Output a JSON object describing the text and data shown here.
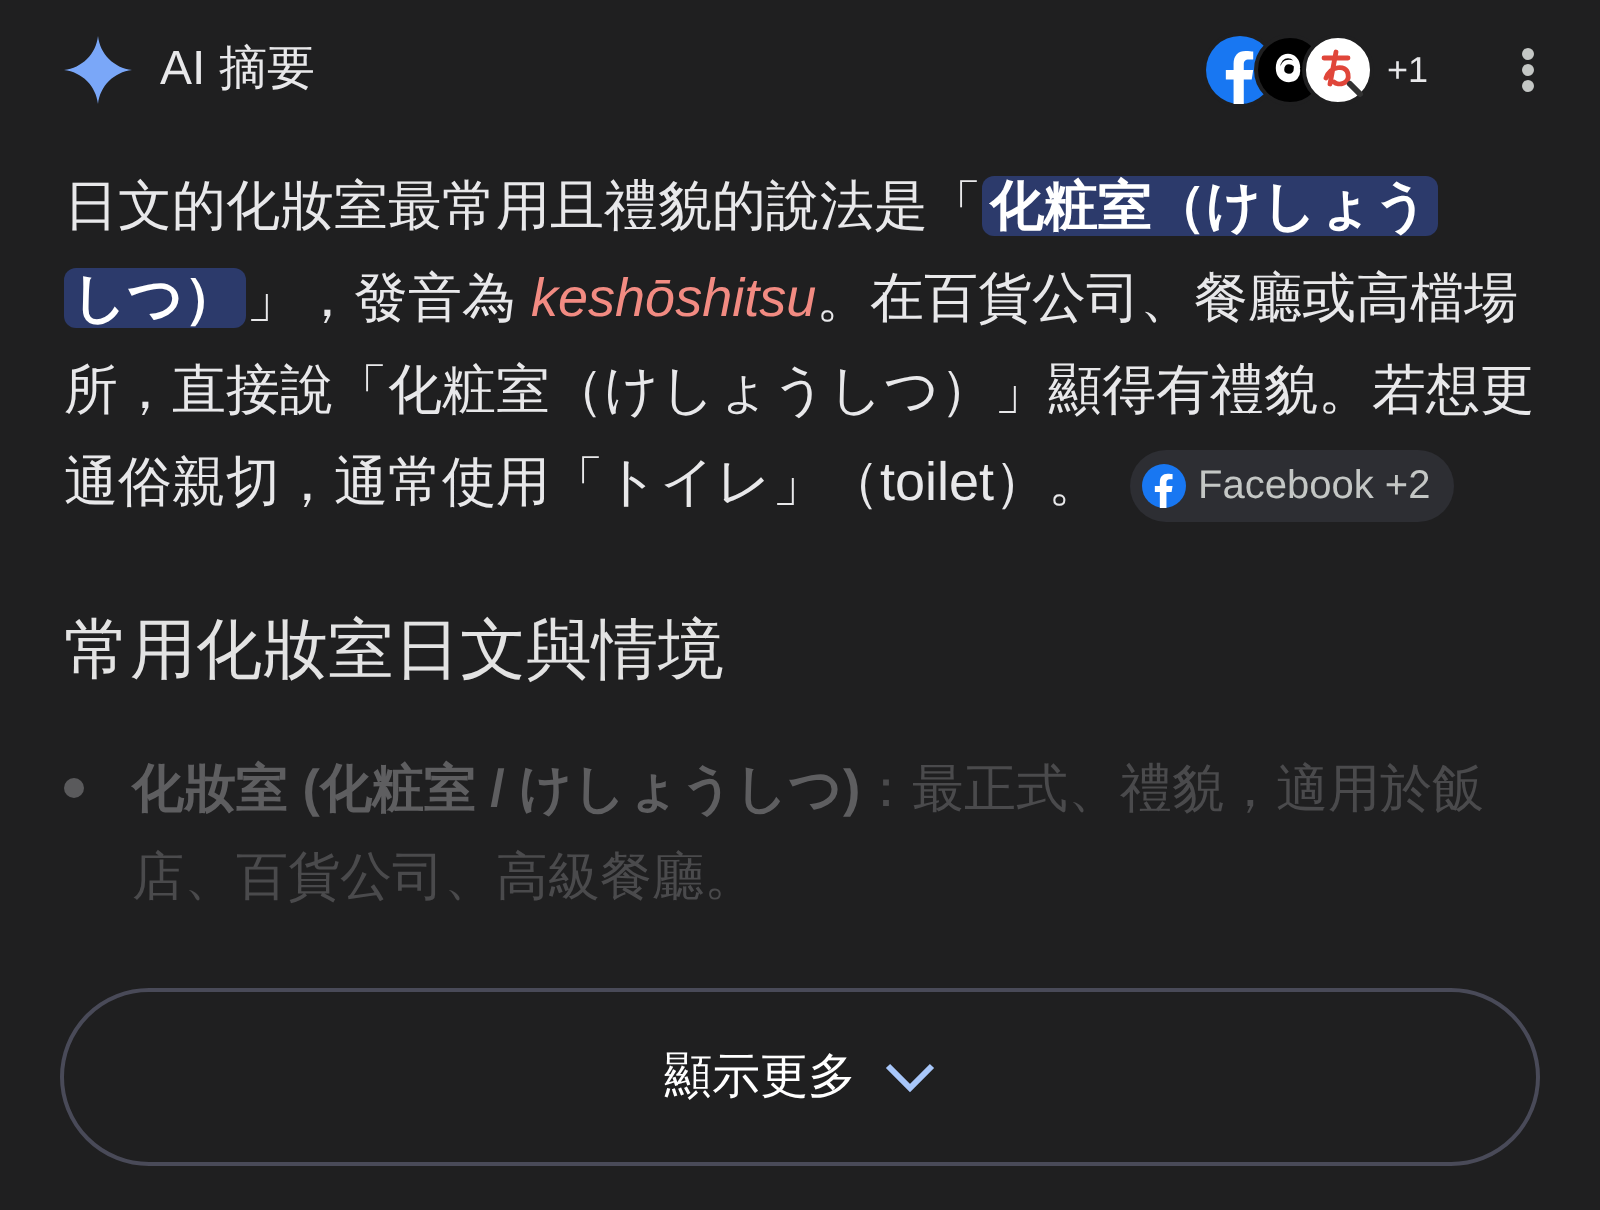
{
  "header": {
    "title": "AI 摘要",
    "sources_more": "+1"
  },
  "summary": {
    "segments": [
      {
        "kind": "plain",
        "text": "日文的化妝室最常用且禮貌的說法是「"
      },
      {
        "kind": "highlight",
        "text": "化粧室（けしょう"
      },
      {
        "kind": "highlight",
        "text": "しつ）"
      },
      {
        "kind": "plain",
        "text": "」，發音為 "
      },
      {
        "kind": "reading",
        "text": "keshōshitsu"
      },
      {
        "kind": "plain",
        "text": "。在百貨公司、餐廳或高檔場所，直接說「化粧室（けしょうしつ）」顯得有禮貌。若想更通俗親切，通常使用「トイレ」（toilet）。"
      }
    ],
    "citation": "Facebook +2"
  },
  "section": {
    "heading": "常用化妝室日文與情境",
    "items": [
      {
        "term": "化妝室 (化粧室 / けしょうしつ)",
        "description": "：最正式、禮貌，適用於飯店、百貨公司、高級餐廳。"
      }
    ]
  },
  "show_more": "顯示更多"
}
